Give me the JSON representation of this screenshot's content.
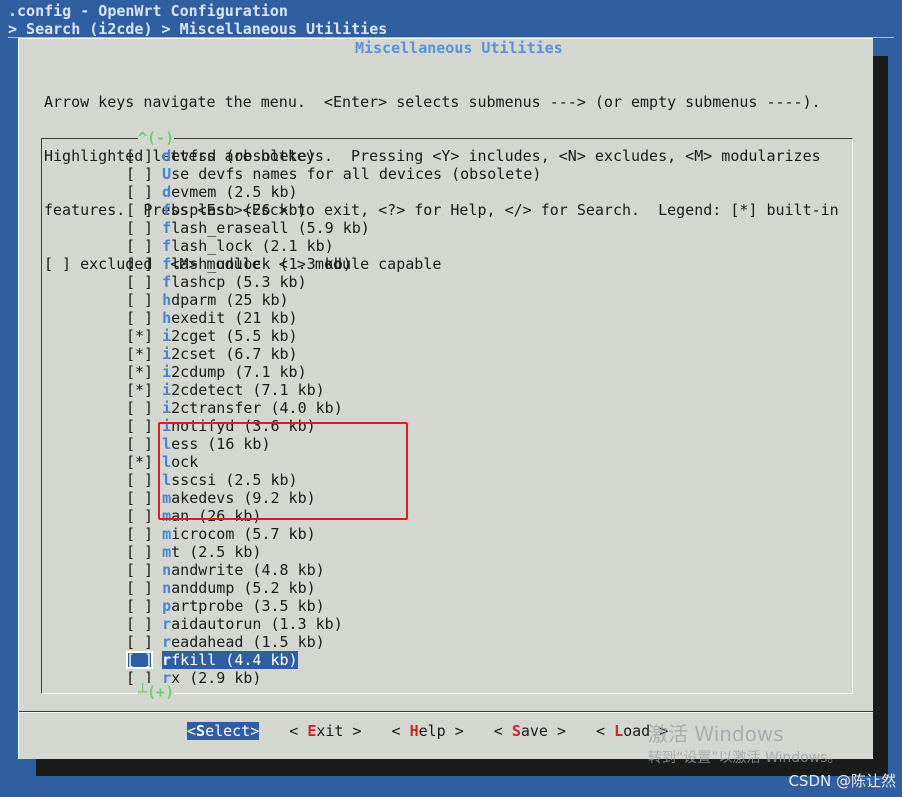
{
  "header": {
    "title": ".config - OpenWrt Configuration",
    "breadcrumb": "> Search (i2cde) > Miscellaneous Utilities"
  },
  "dialog": {
    "title": "Miscellaneous Utilities",
    "help_lines": [
      "Arrow keys navigate the menu.  <Enter> selects submenus ---> (or empty submenus ----).",
      "Highlighted letters are hotkeys.  Pressing <Y> includes, <N> excludes, <M> modularizes",
      "features.  Press <Esc><Esc> to exit, <?> for Help, </> for Search.  Legend: [*] built-in",
      "[ ] excluded  <M> module  < > module capable"
    ],
    "scroll_up": "^(-)",
    "scroll_down": "┴(+)",
    "items": [
      {
        "box": "[ ]",
        "hot": "d",
        "rest": "evfsd (obsolete)"
      },
      {
        "box": "[ ]",
        "hot": "U",
        "rest": "se devfs names for all devices (obsolete)"
      },
      {
        "box": "[ ]",
        "hot": "d",
        "rest": "evmem (2.5 kb)"
      },
      {
        "box": "[ ]",
        "hot": "f",
        "rest": "bsplash (26 kb)"
      },
      {
        "box": "[ ]",
        "hot": "f",
        "rest": "lash_eraseall (5.9 kb)"
      },
      {
        "box": "[ ]",
        "hot": "f",
        "rest": "lash_lock (2.1 kb)"
      },
      {
        "box": "[ ]",
        "hot": "f",
        "rest": "lash_unlock (1.3 kb)"
      },
      {
        "box": "[ ]",
        "hot": "f",
        "rest": "lashcp (5.3 kb)"
      },
      {
        "box": "[ ]",
        "hot": "h",
        "rest": "dparm (25 kb)"
      },
      {
        "box": "[ ]",
        "hot": "h",
        "rest": "exedit (21 kb)"
      },
      {
        "box": "[*]",
        "hot": "i",
        "rest": "2cget (5.5 kb)"
      },
      {
        "box": "[*]",
        "hot": "i",
        "rest": "2cset (6.7 kb)"
      },
      {
        "box": "[*]",
        "hot": "i",
        "rest": "2cdump (7.1 kb)"
      },
      {
        "box": "[*]",
        "hot": "i",
        "rest": "2cdetect (7.1 kb)"
      },
      {
        "box": "[ ]",
        "hot": "i",
        "rest": "2ctransfer (4.0 kb)"
      },
      {
        "box": "[ ]",
        "hot": "i",
        "rest": "notifyd (3.6 kb)"
      },
      {
        "box": "[ ]",
        "hot": "l",
        "rest": "ess (16 kb)"
      },
      {
        "box": "[*]",
        "hot": "l",
        "rest": "ock"
      },
      {
        "box": "[ ]",
        "hot": "l",
        "rest": "sscsi (2.5 kb)"
      },
      {
        "box": "[ ]",
        "hot": "m",
        "rest": "akedevs (9.2 kb)"
      },
      {
        "box": "[ ]",
        "hot": "m",
        "rest": "an (26 kb)"
      },
      {
        "box": "[ ]",
        "hot": "m",
        "rest": "icrocom (5.7 kb)"
      },
      {
        "box": "[ ]",
        "hot": "m",
        "rest": "t (2.5 kb)"
      },
      {
        "box": "[ ]",
        "hot": "n",
        "rest": "andwrite (4.8 kb)"
      },
      {
        "box": "[ ]",
        "hot": "n",
        "rest": "anddump (5.2 kb)"
      },
      {
        "box": "[ ]",
        "hot": "p",
        "rest": "artprobe (3.5 kb)"
      },
      {
        "box": "[ ]",
        "hot": "r",
        "rest": "aidautorun (1.3 kb)"
      },
      {
        "box": "[ ]",
        "hot": "r",
        "rest": "eadahead (1.5 kb)"
      },
      {
        "box": "[ ]",
        "hot": "r",
        "rest": "fkill (4.4 kb)",
        "selected": true
      },
      {
        "box": "[ ]",
        "hot": "r",
        "rest": "x (2.9 kb)"
      }
    ],
    "buttons": [
      {
        "pre": "<",
        "hot": "S",
        "rest": "elect>",
        "active": true
      },
      {
        "pre": "< ",
        "hot": "E",
        "rest": "xit >"
      },
      {
        "pre": "< ",
        "hot": "H",
        "rest": "elp >"
      },
      {
        "pre": "< ",
        "hot": "S",
        "rest": "ave >"
      },
      {
        "pre": "< ",
        "hot": "L",
        "rest": "oad >"
      }
    ]
  },
  "overlay": {
    "watermark_line1": "激活 Windows",
    "watermark_line2": "转到“设置”以激活 Windows。",
    "credit": "CSDN @陈让然"
  },
  "colors": {
    "terminal_bg": "#2f5fa0",
    "dialog_bg": "#d3d7cf",
    "hotkey": "#4b82d6",
    "annotation": "#e11b1b"
  }
}
